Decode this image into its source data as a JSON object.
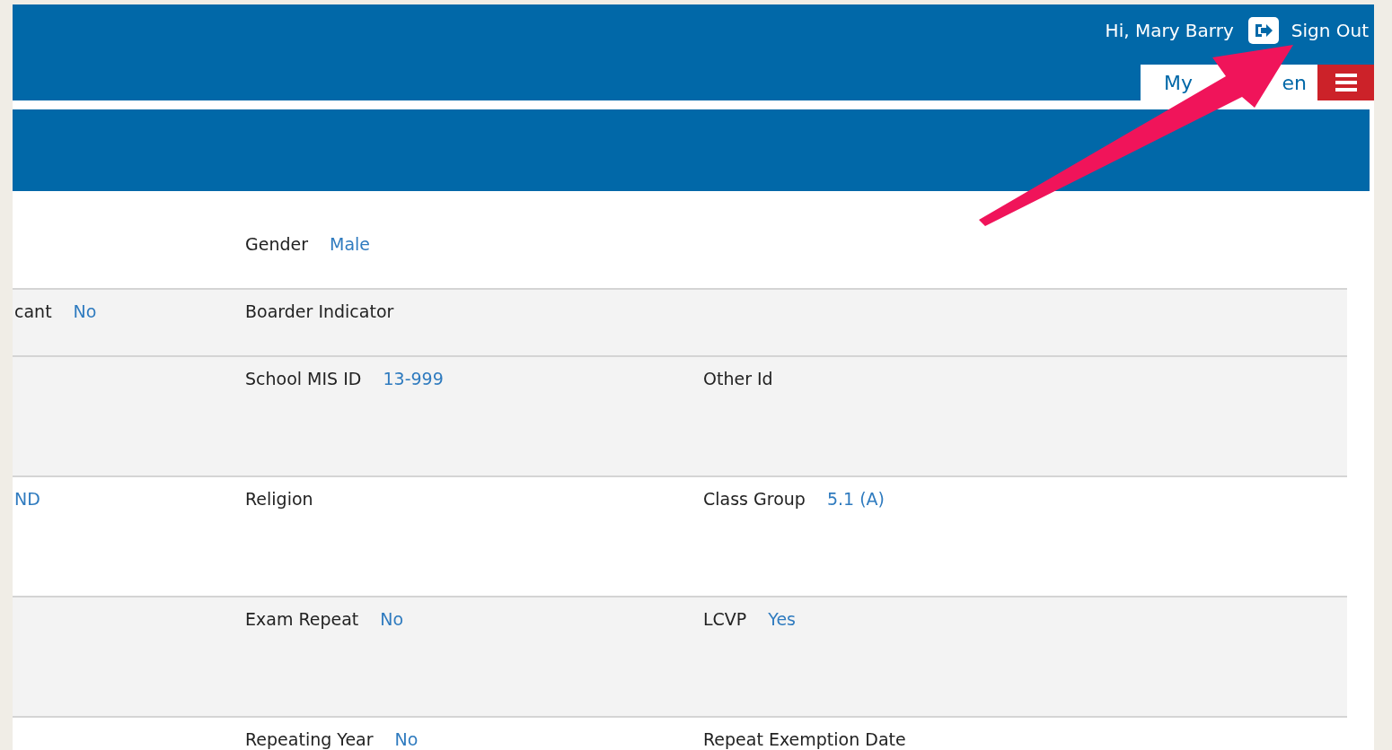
{
  "header": {
    "greeting": "Hi, Mary Barry",
    "sign_out": "Sign Out",
    "tab": {
      "label_parts": [
        "My",
        "en"
      ],
      "selected": true
    }
  },
  "details": [
    {
      "shaded": false,
      "cells": [
        {},
        {
          "label": "Gender",
          "value": "Male"
        },
        {}
      ]
    },
    {
      "shaded": true,
      "cells": [
        {
          "label": "cant",
          "value": "No"
        },
        {
          "label": "Boarder Indicator"
        },
        {}
      ]
    },
    {
      "shaded": true,
      "cells": [
        {},
        {
          "label": "School MIS ID",
          "value": "13-999"
        },
        {
          "label": "Other Id"
        }
      ]
    },
    {
      "shaded": false,
      "cells": [
        {
          "value": "ND"
        },
        {
          "label": "Religion"
        },
        {
          "label": "Class Group",
          "value": "5.1 (A)"
        }
      ]
    },
    {
      "shaded": true,
      "cells": [
        {},
        {
          "label": "Exam Repeat",
          "value": "No"
        },
        {
          "label": "LCVP",
          "value": "Yes"
        }
      ]
    },
    {
      "shaded": false,
      "cells": [
        {},
        {
          "label": "Repeating Year",
          "value": "No"
        },
        {
          "label": "Repeat Exemption Date"
        }
      ]
    }
  ]
}
